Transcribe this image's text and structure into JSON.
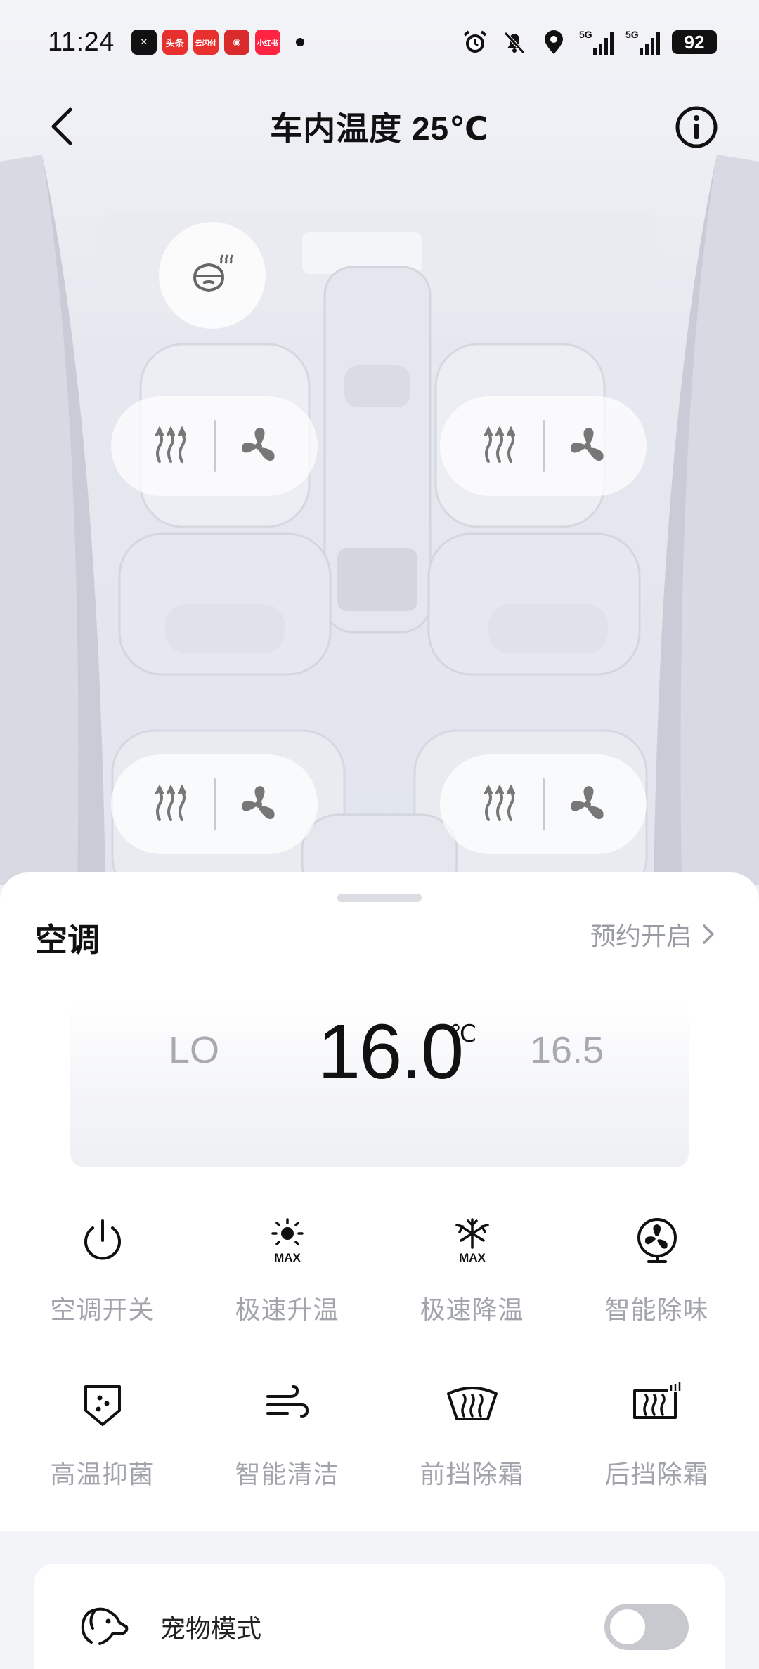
{
  "status_bar": {
    "time": "11:24",
    "apps": [
      {
        "icon": "x-app-icon",
        "color": "#111111",
        "text": ""
      },
      {
        "icon": "toutiao-icon",
        "color": "#e8302e",
        "text": "头条"
      },
      {
        "icon": "yunshanfu-icon",
        "color": "#e8302e",
        "text": "云闪付"
      },
      {
        "icon": "citic-icon",
        "color": "#d92b2b",
        "text": ""
      },
      {
        "icon": "xiaohongshu-icon",
        "color": "#ff2442",
        "text": "小红书"
      }
    ],
    "network": "5G",
    "battery": "92"
  },
  "header": {
    "title": "车内温度 25℃"
  },
  "seats": {
    "front_left": {
      "heat_icon": "seat-heat-icon",
      "fan_icon": "seat-fan-icon"
    },
    "front_right": {
      "heat_icon": "seat-heat-icon",
      "fan_icon": "seat-fan-icon"
    },
    "rear_left": {
      "heat_icon": "seat-heat-icon",
      "fan_icon": "seat-fan-icon"
    },
    "rear_right": {
      "heat_icon": "seat-heat-icon",
      "fan_icon": "seat-fan-icon"
    },
    "steering_wheel_heat_icon": "steering-wheel-heat-icon"
  },
  "ac": {
    "title": "空调",
    "schedule_label": "预约开启",
    "temp_low": "LO",
    "temp_current": "16.0",
    "temp_unit": "℃",
    "temp_next": "16.5"
  },
  "functions": [
    {
      "label": "空调开关",
      "icon": "power-icon"
    },
    {
      "label": "极速升温",
      "icon": "sun-max-icon"
    },
    {
      "label": "极速降温",
      "icon": "snowflake-max-icon"
    },
    {
      "label": "智能除味",
      "icon": "fan-deodorize-icon"
    },
    {
      "label": "高温抑菌",
      "icon": "shield-dots-icon"
    },
    {
      "label": "智能清洁",
      "icon": "wind-clean-icon"
    },
    {
      "label": "前挡除霜",
      "icon": "front-defrost-icon"
    },
    {
      "label": "后挡除霜",
      "icon": "rear-defrost-icon"
    }
  ],
  "pet_mode": {
    "label": "宠物模式",
    "icon": "dog-icon",
    "enabled": false
  },
  "colors": {
    "accent_text": "#111111",
    "muted_text": "#a2a4ab",
    "toggle_off": "#c7c9ce"
  }
}
